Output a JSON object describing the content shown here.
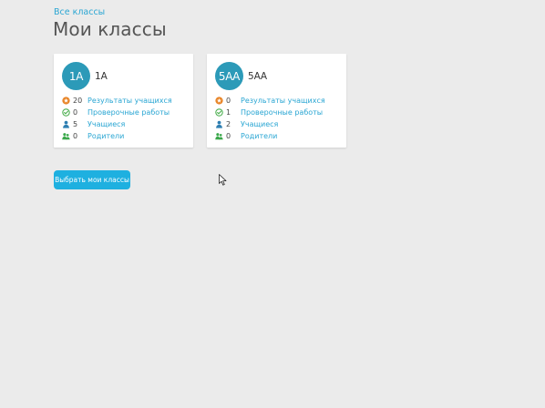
{
  "breadcrumb": {
    "label": "Все классы"
  },
  "page": {
    "title": "Мои классы"
  },
  "classes": [
    {
      "avatar": "1А",
      "name": "1А",
      "stats": [
        {
          "icon": "star-badge-icon",
          "count": "20",
          "label": "Результаты учащихся"
        },
        {
          "icon": "check-circle-icon",
          "count": "0",
          "label": "Проверочные работы"
        },
        {
          "icon": "user-icon",
          "count": "5",
          "label": "Учащиеся"
        },
        {
          "icon": "parents-icon",
          "count": "0",
          "label": "Родители"
        }
      ]
    },
    {
      "avatar": "5АА",
      "name": "5АА",
      "stats": [
        {
          "icon": "star-badge-icon",
          "count": "0",
          "label": "Результаты учащихся"
        },
        {
          "icon": "check-circle-icon",
          "count": "1",
          "label": "Проверочные работы"
        },
        {
          "icon": "user-icon",
          "count": "2",
          "label": "Учащиеся"
        },
        {
          "icon": "parents-icon",
          "count": "0",
          "label": "Родители"
        }
      ]
    }
  ],
  "actions": {
    "select_label": "Выбрать мои классы"
  },
  "colors": {
    "accent": "#1eb0e0",
    "link": "#2aa6d3",
    "avatar_bg": "#2c9ab8",
    "star": "#e8862a",
    "check": "#4caf50",
    "user": "#2f7fb2",
    "parents": "#3aa84a",
    "background": "#ebebeb"
  }
}
